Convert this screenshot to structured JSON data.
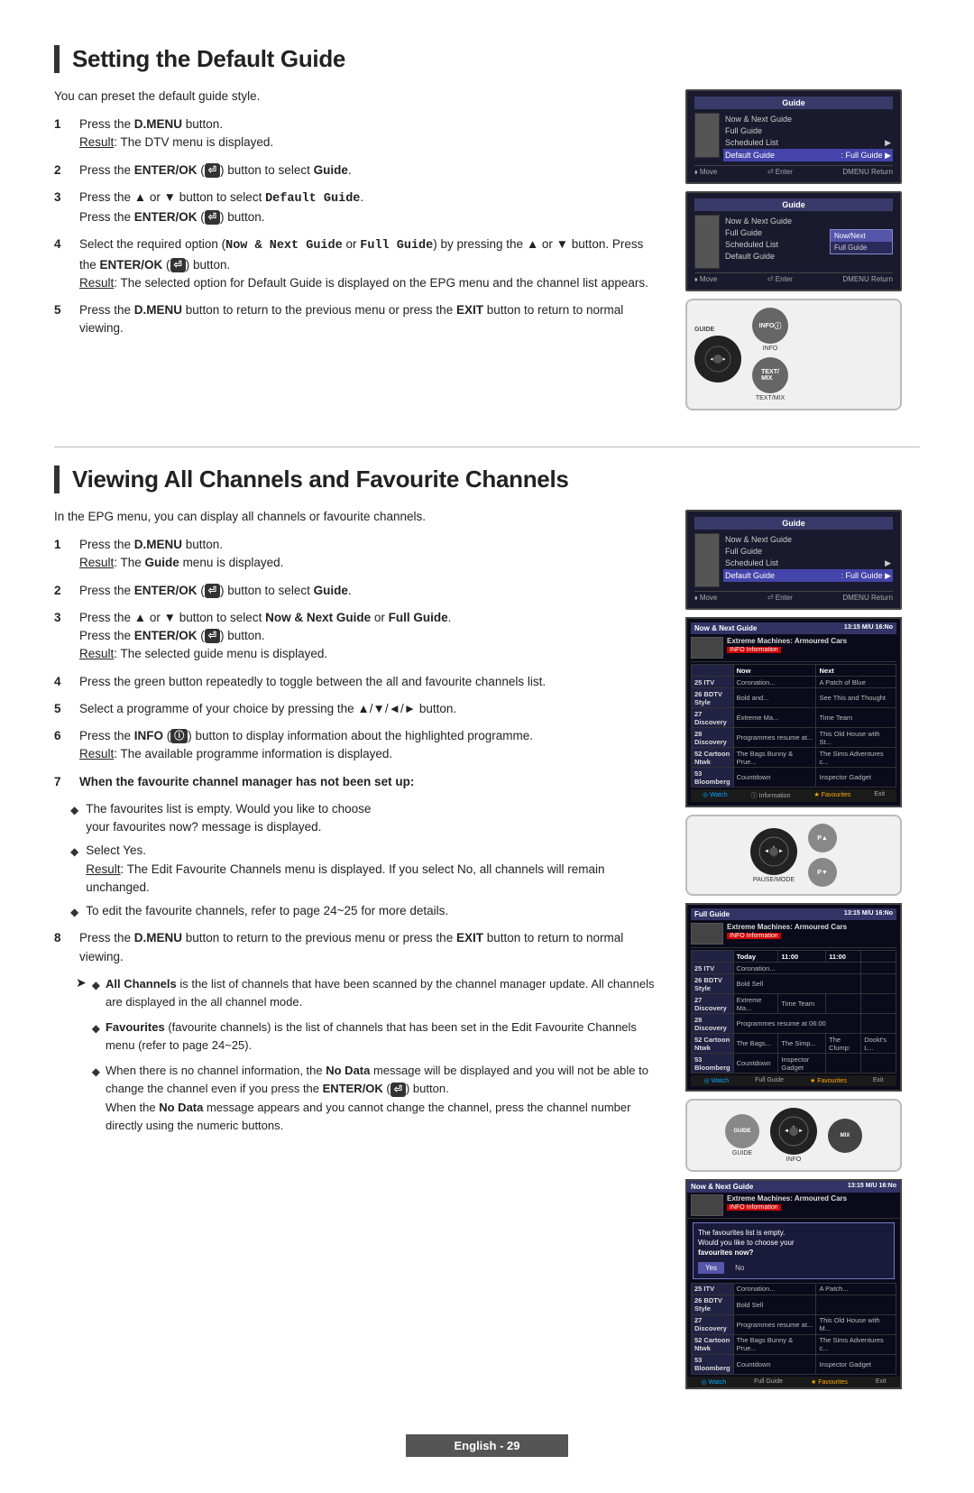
{
  "section1": {
    "title": "Setting the Default Guide",
    "intro": "You can preset the default guide style.",
    "steps": [
      {
        "num": "1",
        "text": "Press the D.MENU button.",
        "result": "The DTV menu is displayed."
      },
      {
        "num": "2",
        "text": "Press the ENTER/OK (⏎) button to select Guide."
      },
      {
        "num": "3",
        "text": "Press the ▲ or ▼ button to select Default Guide.",
        "subtext": "Press the ENTER/OK (⏎) button."
      },
      {
        "num": "4",
        "text": "Select the required option (Now & Next Guide or Full Guide) by pressing the ▲ or ▼ button. Press the ENTER/OK (⏎) button.",
        "result": "The selected option for Default Guide is displayed on the EPG menu and the channel list appears."
      },
      {
        "num": "5",
        "text": "Press the D.MENU button to return to the previous menu or press the EXIT button to return to normal viewing."
      }
    ],
    "screens": [
      {
        "type": "guide_menu",
        "title": "Guide",
        "rows": [
          {
            "label": "Now & Next Guide",
            "value": ""
          },
          {
            "label": "Full Guide",
            "value": ""
          },
          {
            "label": "Scheduled List",
            "value": "▶"
          },
          {
            "label": "Default Guide",
            "value": ": Full Guide ▶",
            "highlight": true
          }
        ]
      },
      {
        "type": "guide_menu2",
        "title": "Guide",
        "rows": [
          {
            "label": "Now & Next Guide",
            "value": ""
          },
          {
            "label": "Full Guide",
            "value": ""
          },
          {
            "label": "Scheduled List",
            "value": ""
          },
          {
            "label": "Default Guide",
            "value": ""
          }
        ],
        "popup_rows": [
          {
            "label": "Now/Next",
            "selected": true
          },
          {
            "label": "Full Guide",
            "selected": false
          }
        ]
      },
      {
        "type": "remote",
        "buttons": [
          "GUIDE",
          "INFO",
          "TEXT/MIX"
        ]
      }
    ]
  },
  "section2": {
    "title": "Viewing All Channels and Favourite Channels",
    "intro": "In the EPG menu, you can display all channels or favourite channels.",
    "steps": [
      {
        "num": "1",
        "text": "Press the D.MENU button.",
        "result": "The Guide menu is displayed."
      },
      {
        "num": "2",
        "text": "Press the ENTER/OK (⏎) button to select Guide."
      },
      {
        "num": "3",
        "text": "Press the ▲ or ▼ button to select Now & Next Guide or Full Guide.",
        "subtext": "Press the ENTER/OK (⏎) button.",
        "result": "The selected guide menu is displayed."
      },
      {
        "num": "4",
        "text": "Press the green button repeatedly to toggle between the all and favourite channels list."
      },
      {
        "num": "5",
        "text": "Select a programme of your choice by pressing the ▲/▼/◄/► button."
      },
      {
        "num": "6",
        "text": "Press the INFO (ⓘ) button to display information about the highlighted programme.",
        "result": "The available programme information is displayed."
      },
      {
        "num": "7",
        "bold": true,
        "text": "When the favourite channel manager has not been set up:"
      }
    ],
    "bullets_step7": [
      {
        "text": "The favourites list is empty. Would you like to choose your favourites now? message is displayed."
      },
      {
        "sub": true,
        "text": "Select Yes.\nResult: The Edit Favourite Channels menu is displayed. If you select No, all channels will remain unchanged."
      },
      {
        "text": "To edit the favourite channels, refer to page 24~25 for more details."
      }
    ],
    "step8": {
      "num": "8",
      "text": "Press the D.MENU button to return to the previous menu or press the EXIT button to return to normal viewing."
    },
    "notes": [
      {
        "text": "All Channels is the list of channels that have been scanned by the channel manager update. All channels are displayed in the all channel mode."
      },
      {
        "text": "Favourites (favourite channels) is the list of channels that has been set in the Edit Favourite Channels menu (refer to page 24~25)."
      },
      {
        "text": "When there is no channel information, the No Data message will be displayed and you will not be able to change the channel even if you press the ENTER/OK (⏎) button.\nWhen the No Data message appears and you cannot change the channel, press the channel number directly using the numeric buttons."
      }
    ],
    "screens": [
      {
        "type": "guide_menu",
        "title": "Guide"
      },
      {
        "type": "epg_now_next",
        "title": "Now & Next Guide"
      },
      {
        "type": "remote2",
        "buttons": [
          "PAUSE/MODE",
          "P▲▼"
        ]
      },
      {
        "type": "epg_full",
        "title": "Full Guide"
      },
      {
        "type": "remote3"
      },
      {
        "type": "epg_fav_dialog",
        "title": "Now & Next Guide"
      }
    ]
  },
  "footer": {
    "label": "English - 29"
  },
  "colors": {
    "accent_blue": "#3333aa",
    "highlight": "#5555cc",
    "border_dark": "#555",
    "text_dark": "#222"
  }
}
